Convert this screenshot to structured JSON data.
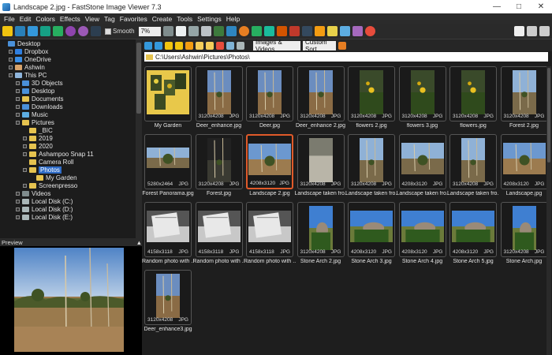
{
  "window": {
    "title": "Landscape 2.jpg - FastStone Image Viewer 7.3"
  },
  "menu": [
    "File",
    "Edit",
    "Colors",
    "Effects",
    "View",
    "Tag",
    "Favorites",
    "Create",
    "Tools",
    "Settings",
    "Help"
  ],
  "toolbar": {
    "smooth_label": "Smooth",
    "zoom_value": "7%"
  },
  "nav": {
    "filter_value": "Images & Videos",
    "sort_value": "Custom Sort"
  },
  "address": "C:\\Users\\Ashwin\\Pictures\\Photos\\",
  "tree": [
    {
      "label": "Desktop",
      "level": 0,
      "icon": "folder-blue-icon",
      "exp": false
    },
    {
      "label": "Dropbox",
      "level": 1,
      "icon": "dropbox-icon",
      "exp": true
    },
    {
      "label": "OneDrive",
      "level": 1,
      "icon": "onedrive-icon",
      "exp": true
    },
    {
      "label": "Ashwin",
      "level": 1,
      "icon": "user-icon",
      "exp": true
    },
    {
      "label": "This PC",
      "level": 1,
      "icon": "pc-icon",
      "exp": true
    },
    {
      "label": "3D Objects",
      "level": 2,
      "icon": "folder-blue-icon",
      "exp": true
    },
    {
      "label": "Desktop",
      "level": 2,
      "icon": "folder-blue-icon",
      "exp": true
    },
    {
      "label": "Documents",
      "level": 2,
      "icon": "folder-icon",
      "exp": true
    },
    {
      "label": "Downloads",
      "level": 2,
      "icon": "folder-blue-icon",
      "exp": true
    },
    {
      "label": "Music",
      "level": 2,
      "icon": "music-icon",
      "exp": true
    },
    {
      "label": "Pictures",
      "level": 2,
      "icon": "folder-icon",
      "exp": true
    },
    {
      "label": "_BIC",
      "level": 3,
      "icon": "folder-icon",
      "exp": false
    },
    {
      "label": "2019",
      "level": 3,
      "icon": "folder-icon",
      "exp": true
    },
    {
      "label": "2020",
      "level": 3,
      "icon": "folder-icon",
      "exp": true
    },
    {
      "label": "Ashampoo Snap 11",
      "level": 3,
      "icon": "folder-icon",
      "exp": true
    },
    {
      "label": "Camera Roll",
      "level": 3,
      "icon": "folder-icon",
      "exp": false
    },
    {
      "label": "Photos",
      "level": 3,
      "icon": "folder-icon",
      "exp": true,
      "selected": true
    },
    {
      "label": "My Garden",
      "level": 4,
      "icon": "folder-icon",
      "exp": false
    },
    {
      "label": "Screenpresso",
      "level": 3,
      "icon": "folder-icon",
      "exp": true
    },
    {
      "label": "Videos",
      "level": 2,
      "icon": "video-icon",
      "exp": true
    },
    {
      "label": "Local Disk (C:)",
      "level": 2,
      "icon": "disk-icon",
      "exp": true
    },
    {
      "label": "Local Disk (D:)",
      "level": 2,
      "icon": "disk-icon",
      "exp": true
    },
    {
      "label": "Local Disk (E:)",
      "level": 2,
      "icon": "disk-icon",
      "exp": true
    }
  ],
  "preview": {
    "label": "Preview"
  },
  "thumbnails": [
    {
      "name": "My Garden",
      "dims": "",
      "fmt": "",
      "kind": "folder"
    },
    {
      "name": "Deer_enhance.jpg",
      "dims": "3120x4208",
      "fmt": "JPG",
      "kind": "portrait",
      "scene": "deer"
    },
    {
      "name": "Deer.jpg",
      "dims": "3120x4208",
      "fmt": "JPG",
      "kind": "portrait",
      "scene": "deer"
    },
    {
      "name": "Deer_enhance 2.jpg",
      "dims": "3120x4208",
      "fmt": "JPG",
      "kind": "portrait",
      "scene": "deer"
    },
    {
      "name": "flowers 2.jpg",
      "dims": "3120x4208",
      "fmt": "JPG",
      "kind": "portrait",
      "scene": "flowers"
    },
    {
      "name": "flowers 3.jpg",
      "dims": "3120x4208",
      "fmt": "JPG",
      "kind": "portrait",
      "scene": "flowers"
    },
    {
      "name": "flowers.jpg",
      "dims": "3120x4208",
      "fmt": "JPG",
      "kind": "portrait",
      "scene": "flowers"
    },
    {
      "name": "Forest 2.jpg",
      "dims": "3120x4208",
      "fmt": "JPG",
      "kind": "portrait",
      "scene": "forest"
    },
    {
      "name": "Forest Panorama.jpg",
      "dims": "5280x2464",
      "fmt": "JPG",
      "kind": "panorama",
      "scene": "forest"
    },
    {
      "name": "Forest.jpg",
      "dims": "3120x4208",
      "fmt": "JPG",
      "kind": "portrait",
      "scene": "dark"
    },
    {
      "name": "Landscape 2.jpg",
      "dims": "4208x3120",
      "fmt": "JPG",
      "kind": "landscape",
      "scene": "land",
      "selected": true
    },
    {
      "name": "Landscape taken fro...",
      "dims": "3120x4208",
      "fmt": "JPG",
      "kind": "portrait",
      "scene": "water"
    },
    {
      "name": "Landscape taken fro...",
      "dims": "3120x4208",
      "fmt": "JPG",
      "kind": "portrait",
      "scene": "forest"
    },
    {
      "name": "Landscape taken fro...",
      "dims": "4208x3120",
      "fmt": "JPG",
      "kind": "landscape",
      "scene": "forest"
    },
    {
      "name": "Landscape taken fro...",
      "dims": "3120x4208",
      "fmt": "JPG",
      "kind": "portrait",
      "scene": "forest"
    },
    {
      "name": "Landscape.jpg",
      "dims": "4208x3120",
      "fmt": "JPG",
      "kind": "landscape",
      "scene": "land"
    },
    {
      "name": "Random photo with ...",
      "dims": "4158x3118",
      "fmt": "JPG",
      "kind": "landscape",
      "scene": "screen"
    },
    {
      "name": "Random photo with ...",
      "dims": "4158x3118",
      "fmt": "JPG",
      "kind": "landscape",
      "scene": "screen"
    },
    {
      "name": "Random photo with ...",
      "dims": "4158x3118",
      "fmt": "JPG",
      "kind": "landscape",
      "scene": "screen"
    },
    {
      "name": "Stone Arch 2.jpg",
      "dims": "3120x4208",
      "fmt": "JPG",
      "kind": "portrait",
      "scene": "rock"
    },
    {
      "name": "Stone Arch 3.jpg",
      "dims": "4208x3120",
      "fmt": "JPG",
      "kind": "landscape",
      "scene": "rock"
    },
    {
      "name": "Stone Arch 4.jpg",
      "dims": "4208x3120",
      "fmt": "JPG",
      "kind": "landscape",
      "scene": "rock"
    },
    {
      "name": "Stone Arch 5.jpg",
      "dims": "4208x3120",
      "fmt": "JPG",
      "kind": "landscape",
      "scene": "rock"
    },
    {
      "name": "Stone Arch.jpg",
      "dims": "3120x4208",
      "fmt": "JPG",
      "kind": "portrait",
      "scene": "rock"
    },
    {
      "name": "Deer_enhance3.jpg",
      "dims": "3120x4208",
      "fmt": "JPG",
      "kind": "portrait",
      "scene": "deer"
    }
  ]
}
